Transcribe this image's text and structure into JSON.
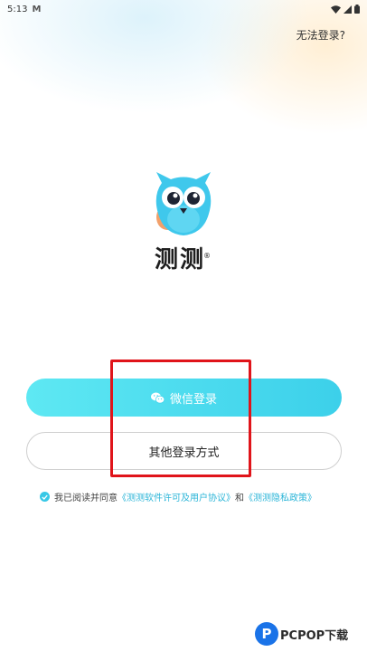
{
  "status_bar": {
    "time": "5:13",
    "notification": "M"
  },
  "header": {
    "cant_login": "无法登录?"
  },
  "app": {
    "name": "测测",
    "registered": "®"
  },
  "buttons": {
    "wechat_login": "微信登录",
    "other_login": "其他登录方式"
  },
  "agreement": {
    "prefix": "我已阅读并同意",
    "license_link": "《测测软件许可及用户协议》",
    "and": "和",
    "privacy_link": "《测测隐私政策》",
    "checked": true
  },
  "watermark": {
    "logo_letter": "P",
    "text": "PCPOP下载"
  },
  "colors": {
    "accent": "#3cd0ea",
    "highlight": "#e0141a"
  }
}
